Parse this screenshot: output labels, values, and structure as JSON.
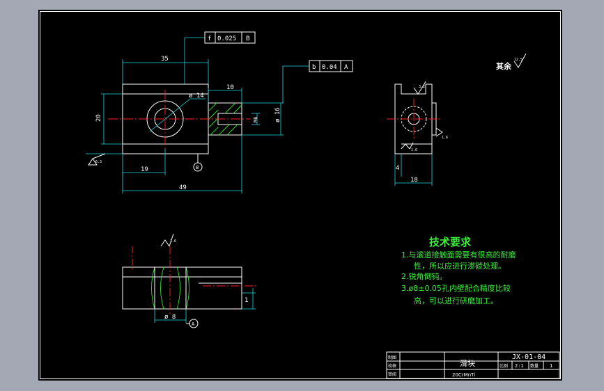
{
  "colors": {
    "background": "#000000",
    "outline": "#ffffff",
    "dimension": "#22d8e6",
    "centerline": "#ff2020",
    "hatch_and_notes": "#30e030"
  },
  "front_view": {
    "tolerance_top": {
      "symbol": "f",
      "value": "0.025",
      "datum": "B"
    },
    "tolerance_right": {
      "symbol": "b",
      "value": "0.04",
      "datum": "A"
    },
    "dim_width_top": "35",
    "dim_boss": "10",
    "dim_height": "20",
    "dim_hole_diameter": "ø 14",
    "dim_boss_diameter": "ø 16",
    "dim_thread": "M6",
    "dim_hole_pos": "19",
    "dim_total": "49",
    "datum_label": "B",
    "roughness_left": "6.3"
  },
  "side_view": {
    "roughness_top": "3.2",
    "roughness_right": "1.6",
    "roughness_bottom": "1.6",
    "dim_left": "4",
    "dim_bottom": "18"
  },
  "section_view": {
    "roughness_top": "1.6",
    "dim_bore": "ø 8",
    "datum_label": "A",
    "dim_right": "1"
  },
  "other_finish": {
    "label": "其余",
    "value": "12.5"
  },
  "tech_requirements": {
    "title": "技术要求",
    "lines": [
      "1.与滚道接触面需要有很高的耐磨",
      "性，所以应进行渗碳处理。",
      "2.锐角倒钝。",
      "3.ø8±0.05孔内壁配合精度比较",
      "高，可以进行研磨加工。"
    ]
  },
  "title_block": {
    "drawing_number": "JX-01-04",
    "part_name": "滑块",
    "material": "20CrMnTi",
    "scale_label": "比例",
    "scale_value": "2:1",
    "qty_label": "数量",
    "qty_value": "1",
    "row_labels": [
      "制图",
      "校核",
      "审阅"
    ]
  }
}
